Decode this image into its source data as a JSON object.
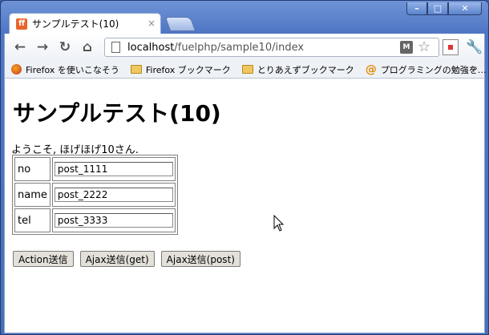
{
  "window": {
    "controls": {
      "minimize": "–",
      "maximize": "□",
      "close": "✕"
    }
  },
  "tab": {
    "title": "サンプルテスト(10)",
    "favicon": "ff",
    "close": "×"
  },
  "toolbar": {
    "back": "←",
    "forward": "→",
    "reload": "↻",
    "home": "⌂",
    "url_host": "localhost",
    "url_path": "/fuelphp/sample10/index",
    "ext_label": "M",
    "star": "☆",
    "wrench": "🔧"
  },
  "bookmarks": {
    "items": [
      {
        "label": "Firefox を使いこなそう",
        "icon": "firefox-icon"
      },
      {
        "label": "Firefox ブックマーク",
        "icon": "folder-icon"
      },
      {
        "label": "とりあえずブックマーク",
        "icon": "folder-icon"
      },
      {
        "label": "プログラミングの勉強を…",
        "icon": "at-icon"
      }
    ],
    "more": "»"
  },
  "page": {
    "heading": "サンプルテスト(10)",
    "welcome": "ようこそ, ほげほげ10さん.",
    "fields": [
      {
        "label": "no",
        "value": "post_1111"
      },
      {
        "label": "name",
        "value": "post_2222"
      },
      {
        "label": "tel",
        "value": "post_3333"
      }
    ],
    "buttons": {
      "action": "Action送信",
      "ajax_get": "Ajax送信(get)",
      "ajax_post": "Ajax送信(post)"
    }
  }
}
